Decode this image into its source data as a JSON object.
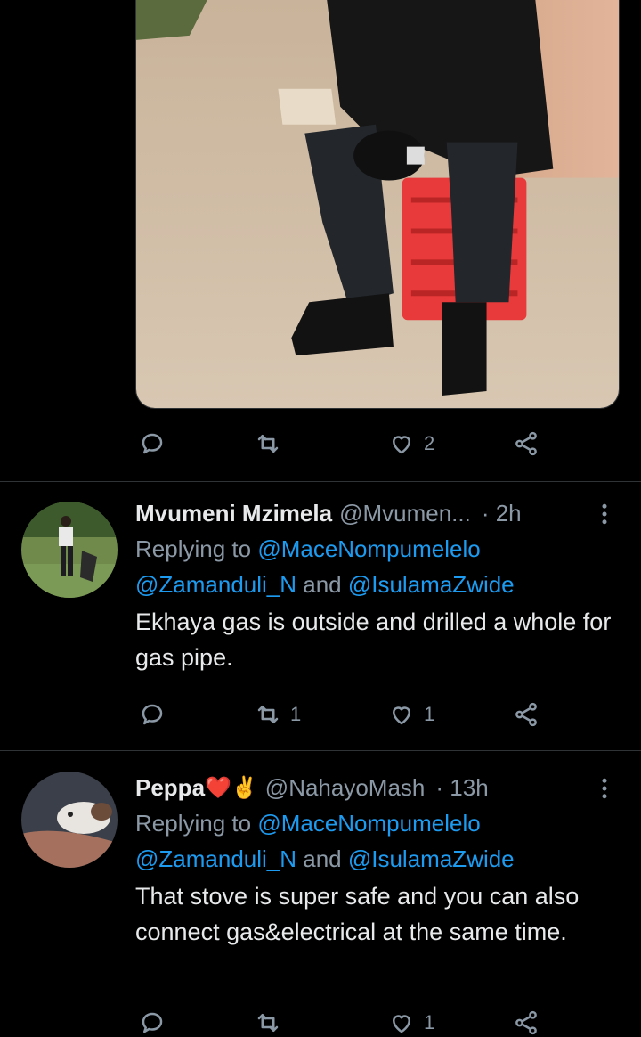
{
  "top_tweet": {
    "image_alt": "photo-person-seated-on-red-crate",
    "actions": {
      "reply_count": "",
      "retweet_count": "",
      "like_count": "2"
    }
  },
  "replies": [
    {
      "name": "Mvumeni Mzimela",
      "name_suffix": "",
      "handle": "@Mvumen...",
      "time": "· 2h",
      "replying_prefix": "Replying to ",
      "mention_1": "@MaceNompumelelo",
      "mention_2": "@Zamanduli_N",
      "and_word": " and ",
      "mention_3": "@IsulamaZwide",
      "text": "Ekhaya gas is outside and drilled a whole for gas pipe.",
      "actions": {
        "reply_count": "",
        "retweet_count": "1",
        "like_count": "1"
      }
    },
    {
      "name": "Peppa",
      "name_suffix": "❤️✌️",
      "handle": "@NahayoMash",
      "time": "· 13h",
      "replying_prefix": "Replying to ",
      "mention_1": "@MaceNompumelelo",
      "mention_2": "@Zamanduli_N",
      "and_word": " and ",
      "mention_3": "@IsulamaZwide",
      "text": "That stove is super safe and you can also connect gas&electrical at the same time.",
      "actions": {
        "reply_count": "",
        "retweet_count": "",
        "like_count": "1"
      }
    }
  ],
  "icons": {
    "reply": "reply-icon",
    "retweet": "retweet-icon",
    "like": "heart-icon",
    "share": "share-icon",
    "more": "more-options-icon"
  },
  "colors": {
    "background": "#000000",
    "text": "#e7e9ea",
    "muted": "#8b98a5",
    "link": "#1d9bf0",
    "divider": "#2f3336"
  }
}
